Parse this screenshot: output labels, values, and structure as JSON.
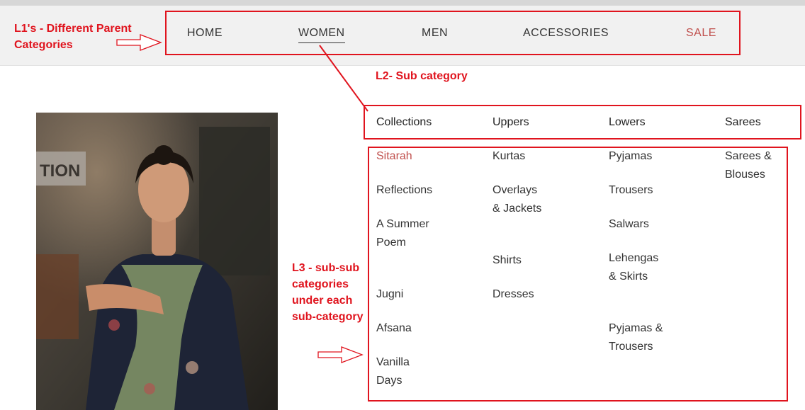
{
  "nav": {
    "items": [
      {
        "label": "HOME"
      },
      {
        "label": "WOMEN"
      },
      {
        "label": "MEN"
      },
      {
        "label": "ACCESSORIES"
      },
      {
        "label": "SALE"
      }
    ],
    "active_index": 1
  },
  "annotations": {
    "l1": "L1's - Different Parent Categories",
    "l2": "L2- Sub category",
    "l3": "L3 - sub-sub categories under each sub-category"
  },
  "menu": {
    "columns": [
      {
        "title": "Collections",
        "items": [
          "Sitarah",
          "Reflections",
          "A Summer Poem",
          "Jugni",
          "Afsana",
          "Vanilla Days"
        ]
      },
      {
        "title": "Uppers",
        "items": [
          "Kurtas",
          "Overlays & Jackets",
          "Shirts",
          "Dresses"
        ]
      },
      {
        "title": "Lowers",
        "items": [
          "Pyjamas",
          "Trousers",
          "Salwars",
          "Lehengas & Skirts",
          "Pyjamas & Trousers"
        ]
      },
      {
        "title": "Sarees",
        "items": [
          "Sarees & Blouses"
        ]
      }
    ]
  },
  "colors": {
    "annotation": "#e0141e",
    "sale": "#c0504d",
    "highlight": "#c0504d",
    "navbar_bg": "#f1f1f1"
  }
}
